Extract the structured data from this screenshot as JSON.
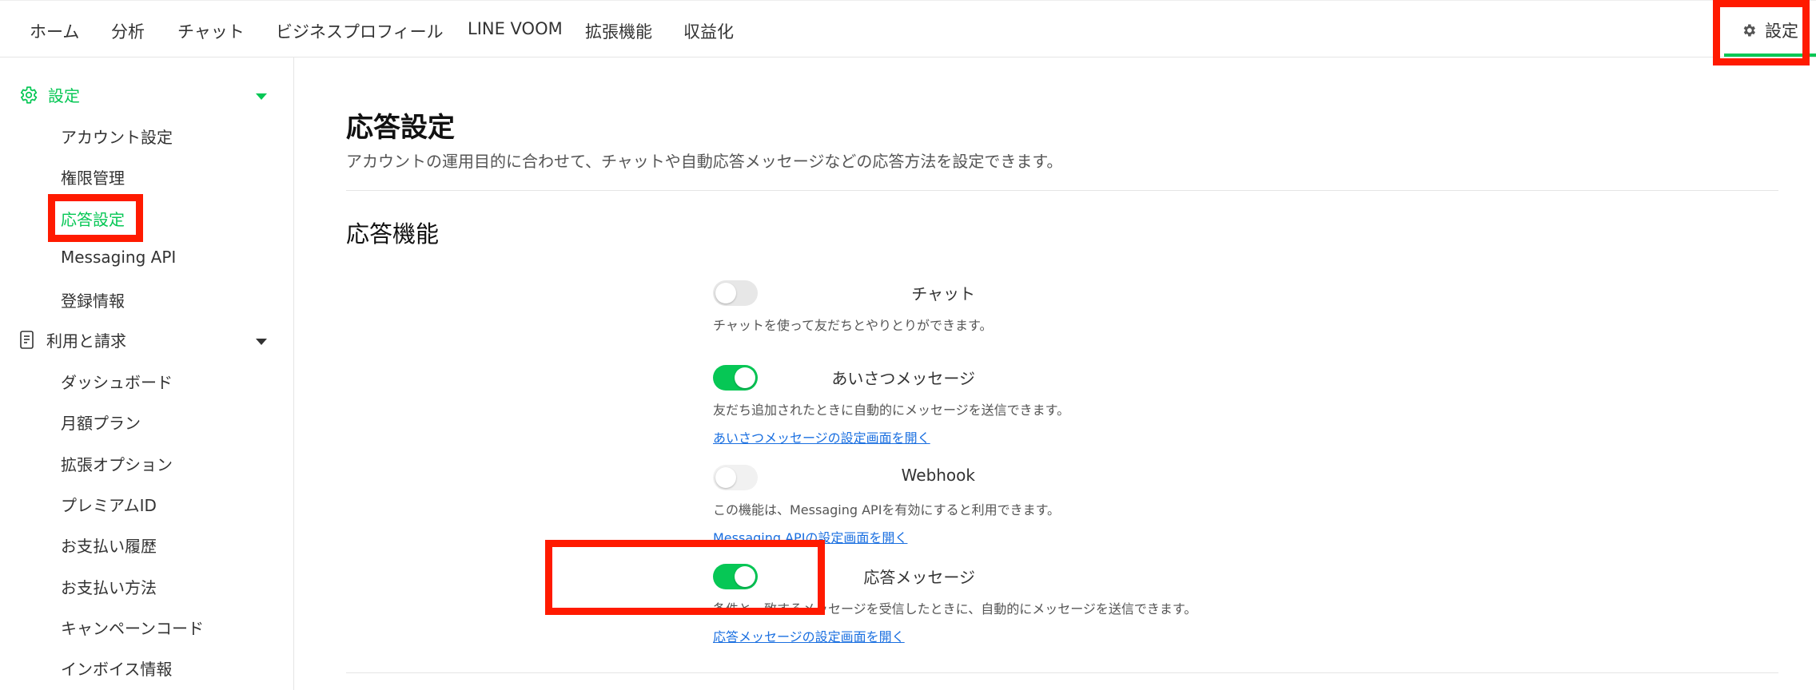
{
  "topnav": {
    "items": [
      "ホーム",
      "分析",
      "チャット",
      "ビジネスプロフィール",
      "LINE VOOM",
      "拡張機能",
      "収益化"
    ],
    "settings_label": "設定"
  },
  "sidebar": {
    "settings_section": {
      "label": "設定",
      "items": [
        "アカウント設定",
        "権限管理",
        "応答設定",
        "Messaging API",
        "登録情報"
      ]
    },
    "billing_section": {
      "label": "利用と請求",
      "items": [
        "ダッシュボード",
        "月額プラン",
        "拡張オプション",
        "プレミアムID",
        "お支払い履歴",
        "お支払い方法",
        "キャンペーンコード",
        "インボイス情報"
      ]
    }
  },
  "main": {
    "title": "応答設定",
    "subtitle": "アカウントの運用目的に合わせて、チャットや自動応答メッセージなどの応答方法を設定できます。",
    "section_title": "応答機能",
    "rows": [
      {
        "label": "チャット",
        "state": "off",
        "desc": "チャットを使って友だちとやりとりができます。",
        "link": ""
      },
      {
        "label": "あいさつメッセージ",
        "state": "on",
        "desc": "友だち追加されたときに自動的にメッセージを送信できます。",
        "link": "あいさつメッセージの設定画面を開く"
      },
      {
        "label": "Webhook",
        "state": "disabled",
        "desc": "この機能は、Messaging APIを有効にすると利用できます。",
        "link": "Messaging APIの設定画面を開く"
      },
      {
        "label": "応答メッセージ",
        "state": "on",
        "desc": "条件と一致するメッセージを受信したときに、自動的にメッセージを送信できます。",
        "link": "応答メッセージの設定画面を開く"
      }
    ]
  },
  "colors": {
    "accent": "#06c755",
    "highlight": "#ff1a00",
    "link": "#1a6fe0"
  },
  "icons": {
    "settings_tab": "gear-icon",
    "settings_section": "gear-outline-icon",
    "billing_section": "document-icon"
  }
}
